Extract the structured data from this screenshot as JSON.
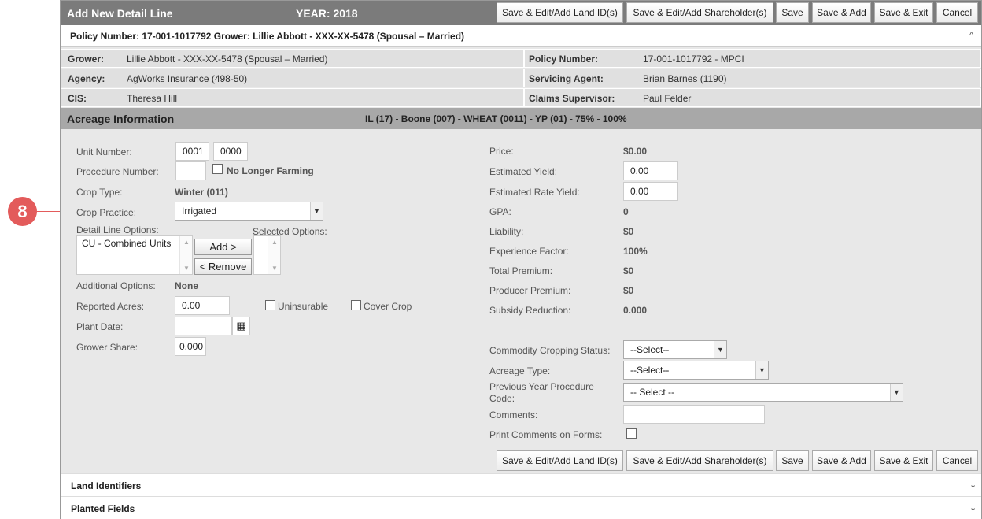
{
  "callout": {
    "number": "8"
  },
  "header": {
    "title": "Add New Detail Line",
    "year": "YEAR: 2018"
  },
  "toolbar": {
    "land_ids": "Save & Edit/Add Land ID(s)",
    "shareholders": "Save & Edit/Add Shareholder(s)",
    "save": "Save",
    "save_add": "Save & Add",
    "save_exit": "Save & Exit",
    "cancel": "Cancel"
  },
  "policy_bar": {
    "text": "Policy Number: 17-001-1017792 Grower: Lillie Abbott - XXX-XX-5478 (Spousal – Married)"
  },
  "info": {
    "grower_label": "Grower:",
    "grower_value": "Lillie Abbott - XXX-XX-5478 (Spousal – Married)",
    "policy_label": "Policy Number:",
    "policy_value": "17-001-1017792 - MPCI",
    "agency_label": "Agency:",
    "agency_value": "AgWorks Insurance (498-50)",
    "agent_label": "Servicing Agent:",
    "agent_value": "Brian Barnes (1190)",
    "cis_label": "CIS:",
    "cis_value": "Theresa Hill",
    "claims_label": "Claims Supervisor:",
    "claims_value": "Paul Felder"
  },
  "acreage": {
    "title": "Acreage Information",
    "summary": "IL (17) - Boone (007) - WHEAT (0011) - YP (01) - 75% - 100%"
  },
  "left_form": {
    "unit_number_label": "Unit Number:",
    "unit_number_a": "0001",
    "unit_number_b": "0000",
    "procedure_number_label": "Procedure Number:",
    "no_longer_farming": "No Longer Farming",
    "crop_type_label": "Crop Type:",
    "crop_type_value": "Winter (011)",
    "crop_practice_label": "Crop Practice:",
    "crop_practice_value": "Irrigated",
    "detail_line_options_label": "Detail Line Options:",
    "selected_options_label": "Selected Options:",
    "available_options": [
      "CU - Combined Units"
    ],
    "add_button": "Add >",
    "remove_button": "< Remove",
    "additional_options_label": "Additional Options:",
    "additional_options_value": "None",
    "reported_acres_label": "Reported Acres:",
    "reported_acres_value": "0.00",
    "uninsurable": "Uninsurable",
    "cover_crop": "Cover Crop",
    "plant_date_label": "Plant Date:",
    "grower_share_label": "Grower Share:",
    "grower_share_value": "0.000"
  },
  "right_form": {
    "price_label": "Price:",
    "price_value": "$0.00",
    "est_yield_label": "Estimated Yield:",
    "est_yield_value": "0.00",
    "est_rate_yield_label": "Estimated Rate Yield:",
    "est_rate_yield_value": "0.00",
    "gpa_label": "GPA:",
    "gpa_value": "0",
    "liability_label": "Liability:",
    "liability_value": "$0",
    "exp_factor_label": "Experience Factor:",
    "exp_factor_value": "100%",
    "total_premium_label": "Total Premium:",
    "total_premium_value": "$0",
    "producer_premium_label": "Producer Premium:",
    "producer_premium_value": "$0",
    "subsidy_label": "Subsidy Reduction:",
    "subsidy_value": "0.000",
    "commodity_label": "Commodity Cropping Status:",
    "commodity_value": "--Select--",
    "acreage_type_label": "Acreage Type:",
    "acreage_type_value": "--Select--",
    "prev_year_label": "Previous Year Procedure Code:",
    "prev_year_value": "-- Select --",
    "comments_label": "Comments:",
    "print_comments_label": "Print Comments on Forms:"
  },
  "sections": {
    "land_identifiers": "Land Identifiers",
    "planted_fields": "Planted Fields"
  }
}
